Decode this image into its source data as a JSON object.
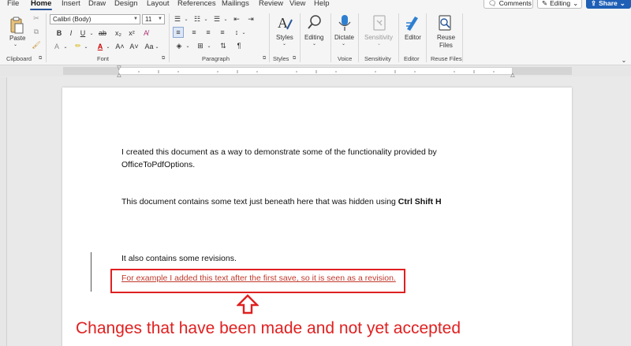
{
  "menu": {
    "tabs": [
      {
        "label": "File"
      },
      {
        "label": "Home"
      },
      {
        "label": "Insert"
      },
      {
        "label": "Draw"
      },
      {
        "label": "Design"
      },
      {
        "label": "Layout"
      },
      {
        "label": "References"
      },
      {
        "label": "Mailings"
      },
      {
        "label": "Review"
      },
      {
        "label": "View"
      },
      {
        "label": "Help"
      }
    ],
    "comments_label": "Comments",
    "editing_label": "Editing",
    "share_label": "Share"
  },
  "ribbon": {
    "clipboard": {
      "paste_label": "Paste",
      "group_label": "Clipboard"
    },
    "font": {
      "font_name": "Calibri (Body)",
      "font_size": "11",
      "group_label": "Font"
    },
    "paragraph": {
      "group_label": "Paragraph"
    },
    "styles": {
      "styles_label": "Styles",
      "group_label": "Styles"
    },
    "editing": {
      "editing_label": "Editing"
    },
    "voice": {
      "dictate_label": "Dictate",
      "group_label": "Voice"
    },
    "sensitivity": {
      "sensitivity_label": "Sensitivity",
      "group_label": "Sensitivity"
    },
    "editor": {
      "editor_label": "Editor",
      "group_label": "Editor"
    },
    "reuse": {
      "reuse_label_1": "Reuse",
      "reuse_label_2": "Files",
      "group_label": "Reuse Files"
    }
  },
  "document": {
    "line1": "I created this document as a way to demonstrate some of the functionality provided by",
    "line2": "OfficeToPdfOptions.",
    "line3_normal": "This document contains some text just beneath here that was hidden using ",
    "line3_bold": "Ctrl Shift H",
    "line4": "It also contains some revisions.",
    "revision_line": "For example I added this text after the first save, so it is seen as a revision."
  },
  "annotation": {
    "text": "Changes that have been made and not yet accepted",
    "color": "#e02020"
  },
  "colors": {
    "accent": "#2b579a",
    "share": "#1f5fb5",
    "revision": "#c0392b"
  }
}
